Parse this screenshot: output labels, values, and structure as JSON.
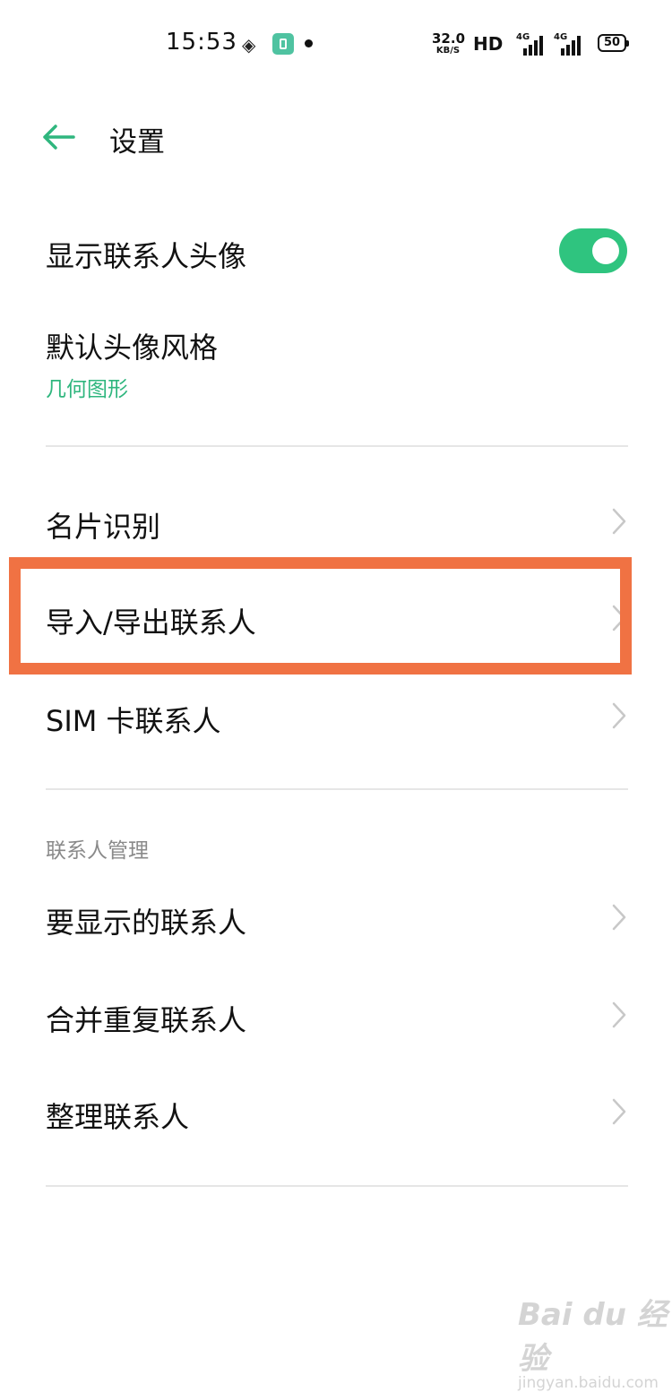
{
  "status_bar": {
    "time": "15:53",
    "speed_value": "32.0",
    "speed_unit": "KB/S",
    "hd_label": "HD",
    "signal1_label": "4G",
    "signal2_label": "4G",
    "battery": "50"
  },
  "header": {
    "title": "设置",
    "accent_color": "#2fb67e"
  },
  "settings": {
    "show_avatar": {
      "label": "显示联系人头像",
      "enabled": true
    },
    "avatar_style": {
      "label": "默认头像风格",
      "value": "几何图形"
    },
    "business_card": {
      "label": "名片识别"
    },
    "import_export": {
      "label": "导入/导出联系人"
    },
    "sim_contacts": {
      "label": "SIM 卡联系人"
    }
  },
  "section_management": {
    "title": "联系人管理",
    "items": [
      {
        "label": "要显示的联系人"
      },
      {
        "label": "合并重复联系人"
      },
      {
        "label": "整理联系人"
      }
    ]
  },
  "highlight_color": "#f07243",
  "watermark": {
    "main": "Bai du 经验",
    "sub": "jingyan.baidu.com"
  }
}
